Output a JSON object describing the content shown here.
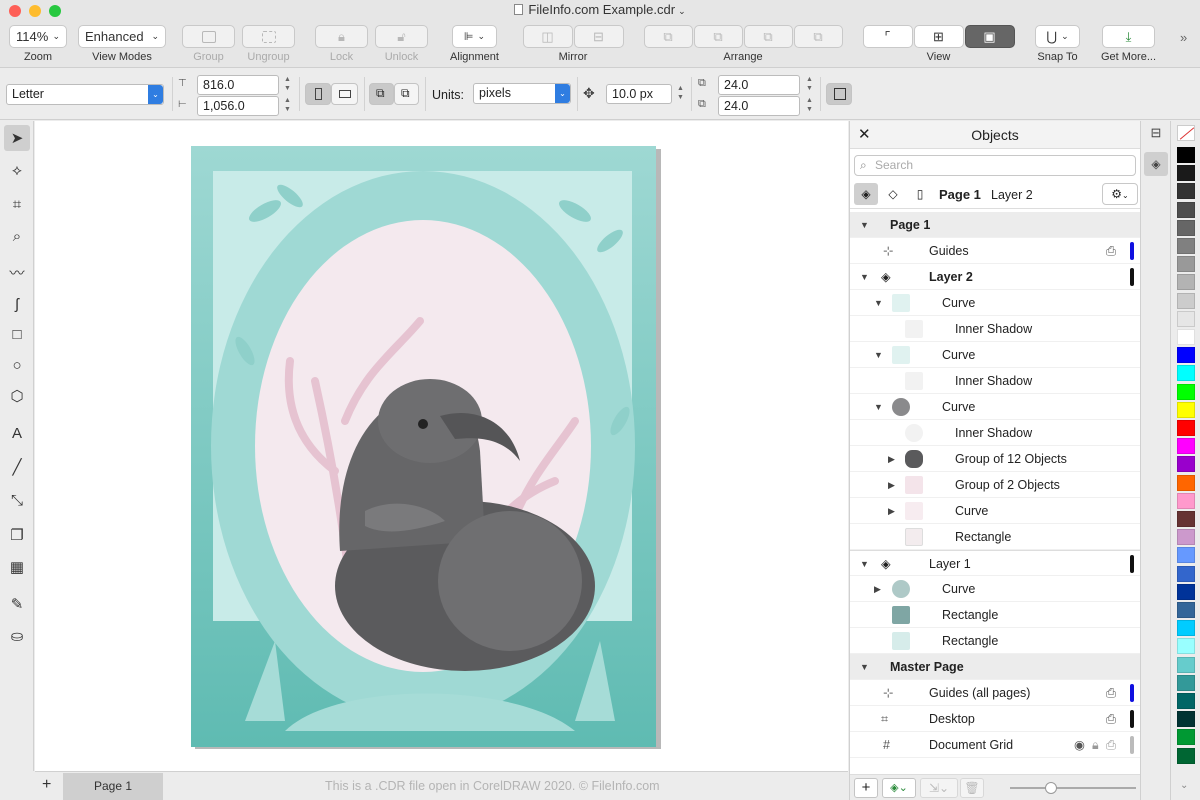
{
  "window": {
    "title": "FileInfo.com Example.cdr"
  },
  "toolbar": {
    "zoom": {
      "value": "114%",
      "label": "Zoom"
    },
    "view_modes": {
      "value": "Enhanced",
      "label": "View Modes"
    },
    "group": "Group",
    "ungroup": "Ungroup",
    "lock": "Lock",
    "unlock": "Unlock",
    "alignment": "Alignment",
    "mirror": "Mirror",
    "arrange": "Arrange",
    "view": "View",
    "snap_to": "Snap To",
    "get_more": "Get More..."
  },
  "properties": {
    "page_size": "Letter",
    "width": "816.0",
    "height": "1,056.0",
    "units_label": "Units:",
    "units": "pixels",
    "nudge": "10.0 px",
    "dup_x": "24.0",
    "dup_y": "24.0"
  },
  "pagebar": {
    "tab": "Page 1",
    "status": "This is a .CDR file open in CorelDRAW 2020. © FileInfo.com"
  },
  "objects_panel": {
    "title": "Objects",
    "search_placeholder": "Search",
    "page": "Page 1",
    "layer": "Layer 2",
    "rows": [
      {
        "label": "Page 1"
      },
      {
        "label": "Guides"
      },
      {
        "label": "Layer 2"
      },
      {
        "label": "Curve"
      },
      {
        "label": "Inner Shadow"
      },
      {
        "label": "Curve"
      },
      {
        "label": "Inner Shadow"
      },
      {
        "label": "Curve"
      },
      {
        "label": "Inner Shadow"
      },
      {
        "label": "Group of 12 Objects"
      },
      {
        "label": "Group of 2 Objects"
      },
      {
        "label": "Curve"
      },
      {
        "label": "Rectangle"
      },
      {
        "label": "Layer 1"
      },
      {
        "label": "Curve"
      },
      {
        "label": "Rectangle"
      },
      {
        "label": "Rectangle"
      },
      {
        "label": "Master Page"
      },
      {
        "label": "Guides (all pages)"
      },
      {
        "label": "Desktop"
      },
      {
        "label": "Document Grid"
      }
    ]
  },
  "palette_colors": [
    "#000000",
    "#1a1a1a",
    "#333333",
    "#4d4d4d",
    "#666666",
    "#808080",
    "#999999",
    "#b3b3b3",
    "#cccccc",
    "#e6e6e6",
    "#ffffff",
    "#0000ff",
    "#00ffff",
    "#00ff00",
    "#ffff00",
    "#ff0000",
    "#ff00ff",
    "#9900cc",
    "#ff6600",
    "#ff99cc",
    "#663333",
    "#cc99cc",
    "#6699ff",
    "#3366cc",
    "#003399",
    "#336699",
    "#00ccff",
    "#99ffff",
    "#66cccc",
    "#339999",
    "#006666",
    "#003333",
    "#009933",
    "#006633"
  ]
}
